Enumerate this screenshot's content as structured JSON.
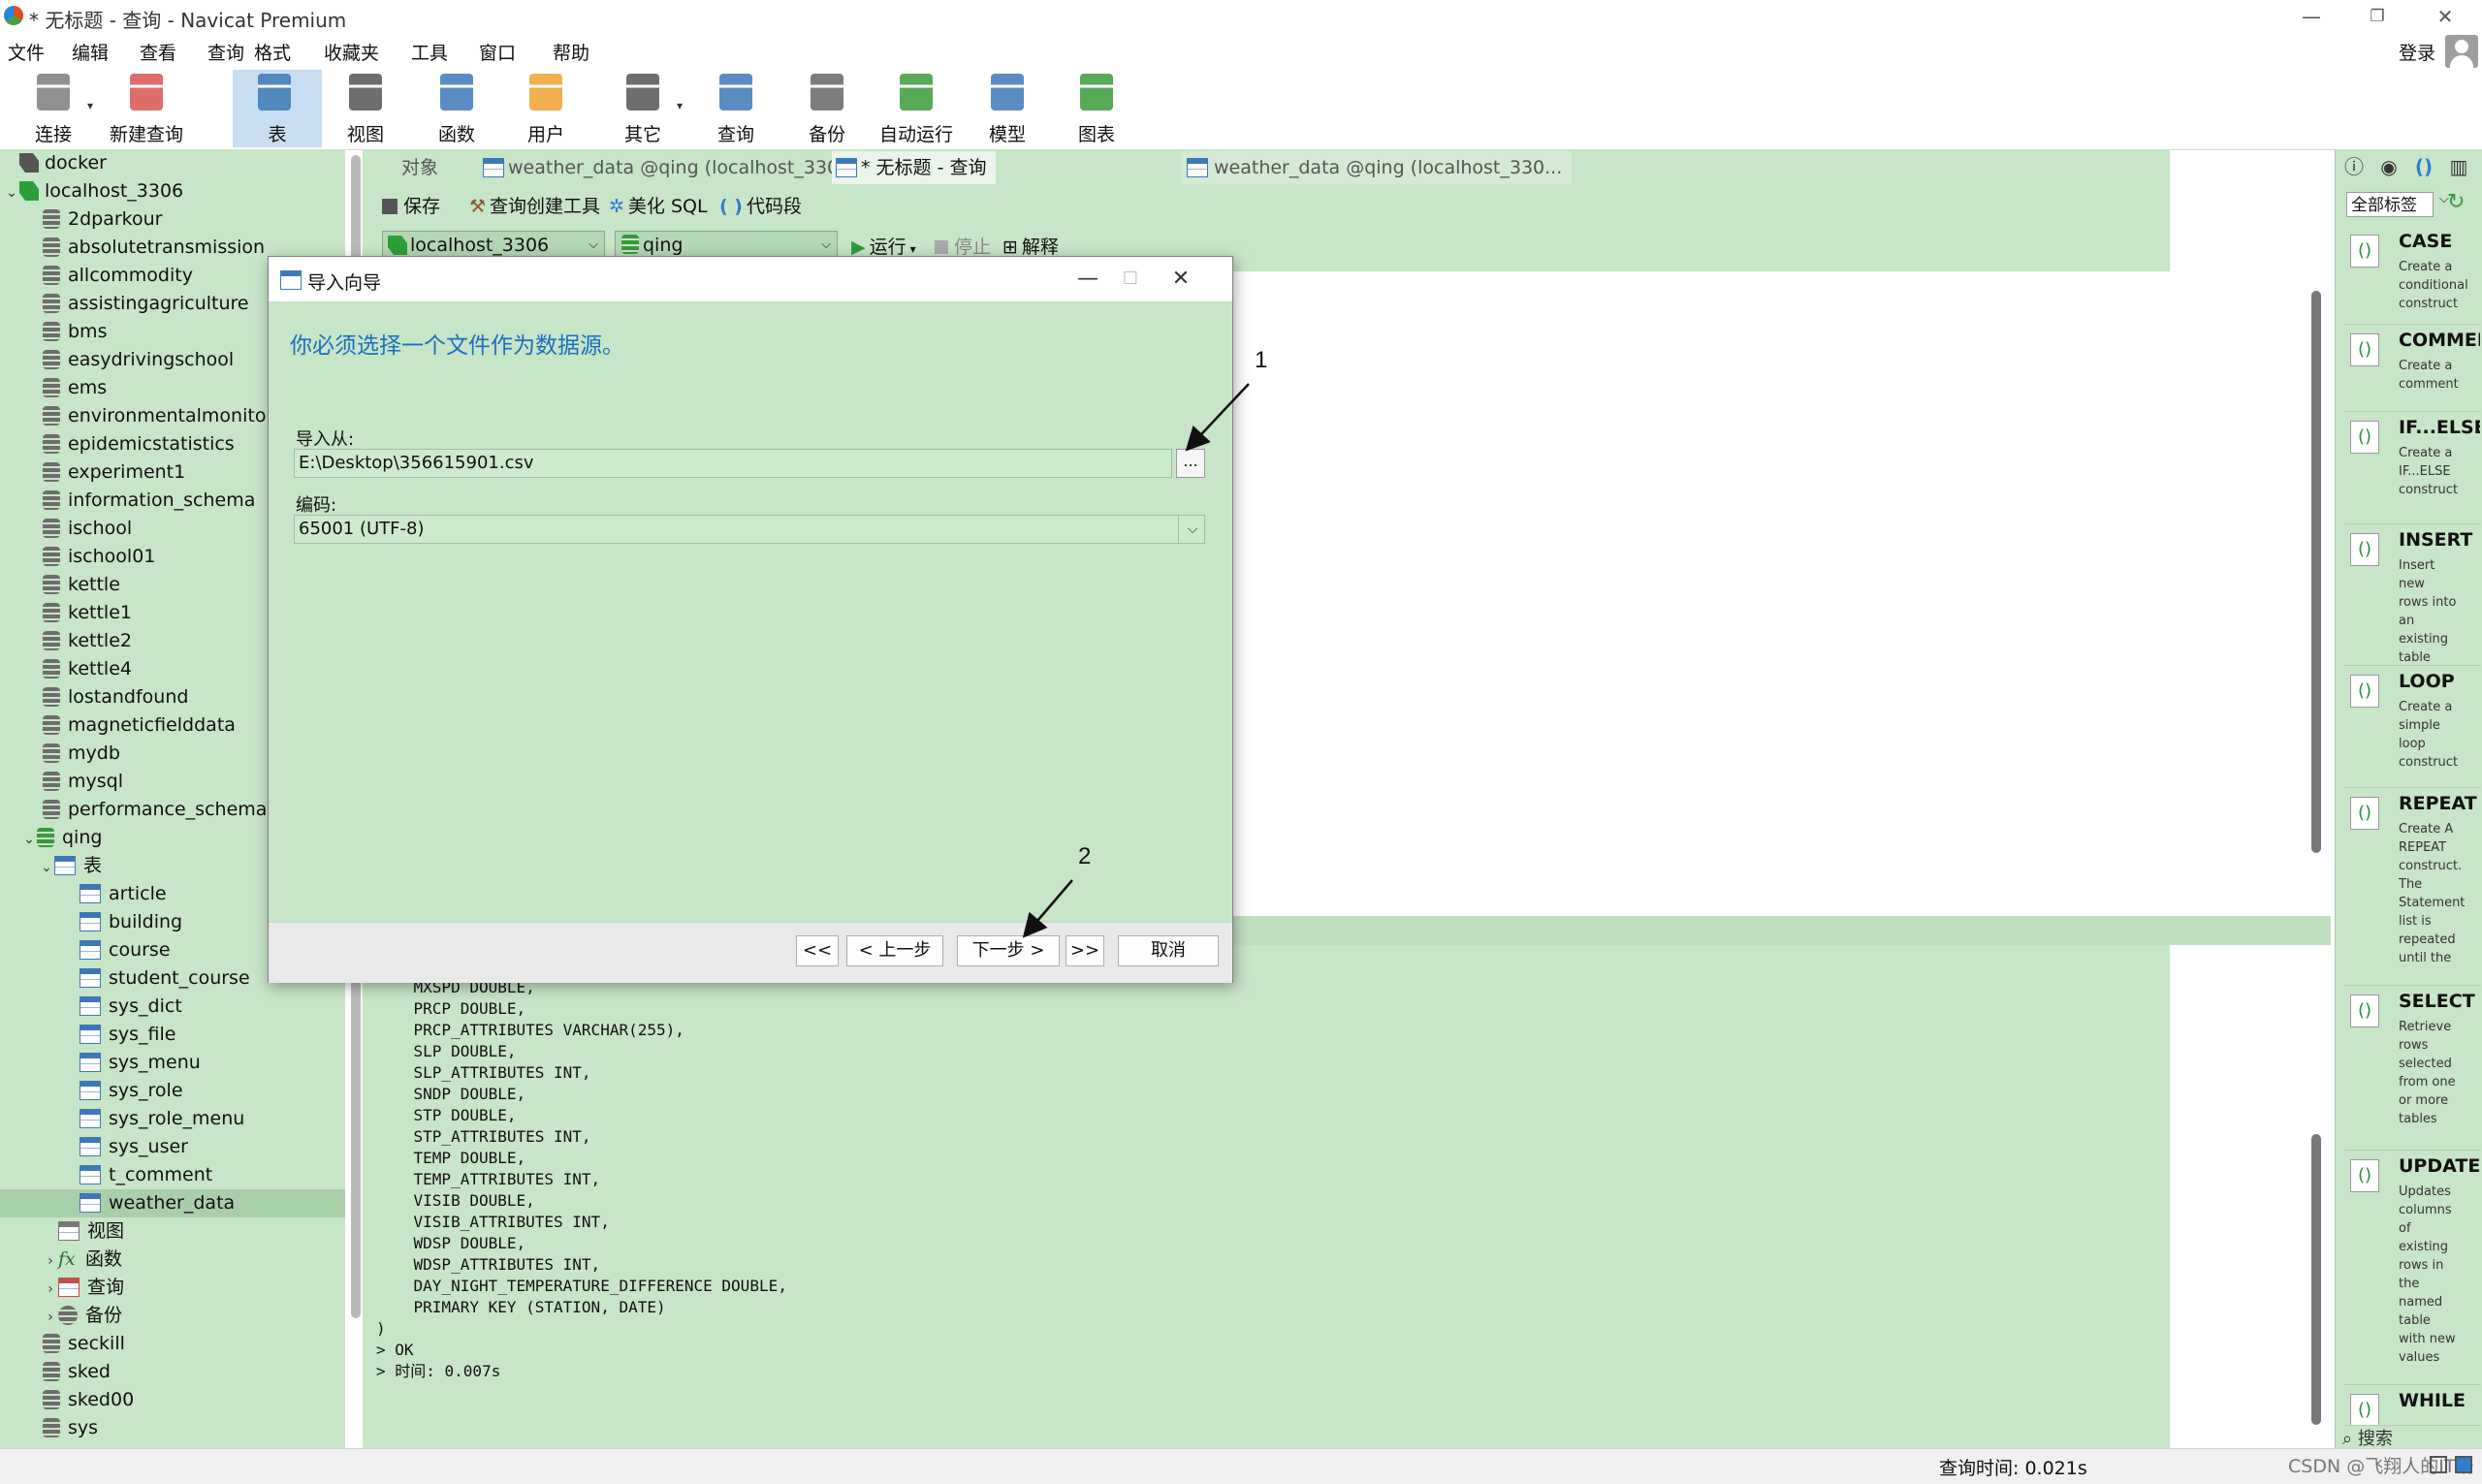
{
  "window": {
    "title": "* 无标题 - 查询 - Navicat Premium",
    "minimize": "—",
    "maximize": "❐",
    "close": "✕"
  },
  "menu": [
    "文件",
    "编辑",
    "查看",
    "查询",
    "格式",
    "收藏夹",
    "工具",
    "窗口",
    "帮助"
  ],
  "account": {
    "login": "登录"
  },
  "toolbar": [
    {
      "label": "连接",
      "icon": "plug-icon",
      "color": "#7d7d7d"
    },
    {
      "label": "新建查询",
      "icon": "new-query-icon",
      "color": "#d9534f"
    },
    {
      "label": "表",
      "icon": "table-icon",
      "color": "#3d78b8"
    },
    {
      "label": "视图",
      "icon": "view-icon",
      "color": "#555555"
    },
    {
      "label": "函数",
      "icon": "function-icon",
      "color": "#3d78b8"
    },
    {
      "label": "用户",
      "icon": "user-icon",
      "color": "#f0a030"
    },
    {
      "label": "其它",
      "icon": "tools-icon",
      "color": "#555555"
    },
    {
      "label": "查询",
      "icon": "query-icon",
      "color": "#3d78b8"
    },
    {
      "label": "备份",
      "icon": "backup-icon",
      "color": "#666666"
    },
    {
      "label": "自动运行",
      "icon": "auto-run-icon",
      "color": "#3a9a3a"
    },
    {
      "label": "模型",
      "icon": "model-icon",
      "color": "#3d78b8"
    },
    {
      "label": "图表",
      "icon": "chart-icon",
      "color": "#3a9a3a"
    }
  ],
  "tree": {
    "connections": [
      {
        "label": "docker",
        "expanded": false
      },
      {
        "label": "localhost_3306",
        "expanded": true
      }
    ],
    "databases_before": [
      "2dparkour",
      "absolutetransmission",
      "allcommodity",
      "assistingagriculture",
      "bms",
      "easydrivingschool",
      "ems",
      "environmentalmonitorin",
      "epidemicstatistics",
      "experiment1",
      "information_schema",
      "ischool",
      "ischool01",
      "kettle",
      "kettle1",
      "kettle2",
      "kettle4",
      "lostandfound",
      "magneticfielddata",
      "mydb",
      "mysql",
      "performance_schema"
    ],
    "open_db": "qing",
    "tables_group": "表",
    "tables": [
      "article",
      "building",
      "course",
      "student_course",
      "sys_dict",
      "sys_file",
      "sys_menu",
      "sys_role",
      "sys_role_menu",
      "sys_user",
      "t_comment",
      "weather_data"
    ],
    "selected_table": "weather_data",
    "other_groups": [
      "视图",
      "函数",
      "查询",
      "备份"
    ],
    "databases_after": [
      "seckill",
      "sked",
      "sked00",
      "sys"
    ]
  },
  "tabs": [
    {
      "label": "对象",
      "active": false
    },
    {
      "label": "weather_data @qing (localhost_330...",
      "active": false
    },
    {
      "label": "* 无标题 - 查询",
      "active": true
    },
    {
      "label": "weather_data @qing (localhost_330...",
      "active": false
    }
  ],
  "query_toolbar": {
    "save": "保存",
    "builder": "查询创建工具",
    "beautify": "美化 SQL",
    "snippet": "代码段",
    "connection": "localhost_3306",
    "database": "qing",
    "run": "运行",
    "stop": "停止",
    "explain": "解释"
  },
  "output_lines": [
    "MXSPD DOUBLE,",
    "PRCP DOUBLE,",
    "PRCP_ATTRIBUTES VARCHAR(255),",
    "SLP DOUBLE,",
    "SLP_ATTRIBUTES INT,",
    "SNDP DOUBLE,",
    "STP DOUBLE,",
    "STP_ATTRIBUTES INT,",
    "TEMP DOUBLE,",
    "TEMP_ATTRIBUTES INT,",
    "VISIB DOUBLE,",
    "VISIB_ATTRIBUTES INT,",
    "WDSP DOUBLE,",
    "WDSP_ATTRIBUTES INT,",
    "DAY_NIGHT_TEMPERATURE_DIFFERENCE DOUBLE,",
    "PRIMARY KEY (STATION, DATE)"
  ],
  "output_tail": [
    ")",
    "> OK",
    "> 时间: 0.007s"
  ],
  "right_panel": {
    "filter": "全部标签",
    "snippets": [
      {
        "title": "CASE",
        "desc": "Create a conditional construct"
      },
      {
        "title": "COMMENT",
        "desc": "Create a comment"
      },
      {
        "title": "IF...ELSE",
        "desc": "Create a IF...ELSE construct"
      },
      {
        "title": "INSERT",
        "desc": "Insert new rows into an existing table"
      },
      {
        "title": "LOOP",
        "desc": "Create a simple loop construct"
      },
      {
        "title": "REPEAT",
        "desc": "Create A REPEAT construct. The Statement list is repeated until the"
      },
      {
        "title": "SELECT",
        "desc": "Retrieve rows selected from one or more tables"
      },
      {
        "title": "UPDATE",
        "desc": "Updates columns of existing rows in the named table with new values"
      },
      {
        "title": "WHILE",
        "desc": ""
      }
    ],
    "search": "搜索"
  },
  "status": {
    "query_time": "查询时间: 0.021s",
    "watermark": "CSDN @飞翔人的IT研"
  },
  "dialog": {
    "title": "导入向导",
    "heading": "你必须选择一个文件作为数据源。",
    "import_from_label": "导入从:",
    "import_path": "E:\\Desktop\\356615901.csv",
    "browse": "...",
    "encoding_label": "编码:",
    "encoding": "65001 (UTF-8)",
    "buttons": {
      "first": "<<",
      "prev": "< 上一步",
      "next": "下一步 >",
      "last": ">>",
      "cancel": "取消"
    },
    "annotations": [
      "1",
      "2"
    ]
  }
}
